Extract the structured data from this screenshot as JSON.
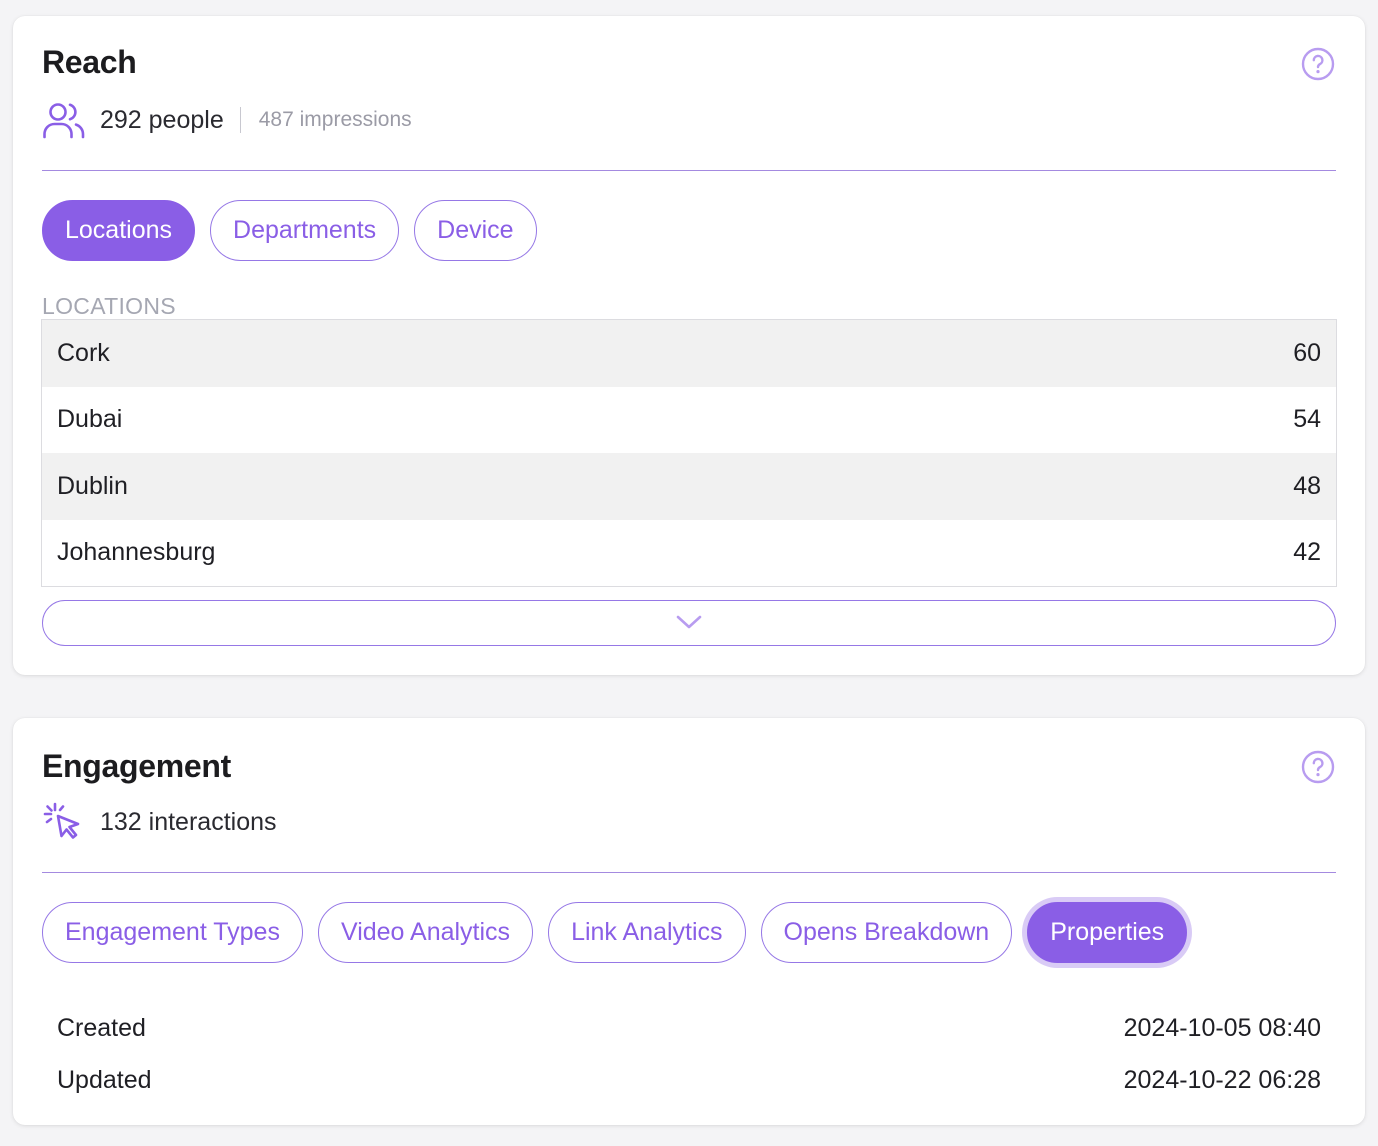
{
  "reach": {
    "title": "Reach",
    "people": "292 people",
    "impressions": "487 impressions",
    "tabs": [
      "Locations",
      "Departments",
      "Device"
    ],
    "active_tab": "Locations",
    "section_label": "LOCATIONS",
    "locations": [
      {
        "name": "Cork",
        "count": "60"
      },
      {
        "name": "Dubai",
        "count": "54"
      },
      {
        "name": "Dublin",
        "count": "48"
      },
      {
        "name": "Johannesburg",
        "count": "42"
      }
    ]
  },
  "engagement": {
    "title": "Engagement",
    "interactions": "132 interactions",
    "tabs": [
      "Engagement Types",
      "Video Analytics",
      "Link Analytics",
      "Opens Breakdown",
      "Properties"
    ],
    "active_tab": "Properties",
    "properties": [
      {
        "label": "Created",
        "value": "2024-10-05 08:40"
      },
      {
        "label": "Updated",
        "value": "2024-10-22 06:28"
      }
    ]
  },
  "colors": {
    "accent": "#8a5ee6",
    "accent_light": "#d9cbf6",
    "divider": "#a48ae0",
    "muted_text": "#9b9ba6"
  },
  "icons": {
    "help": "question-circle-icon",
    "people": "users-icon",
    "interactions": "cursor-click-icon",
    "expand": "chevron-down-icon"
  }
}
